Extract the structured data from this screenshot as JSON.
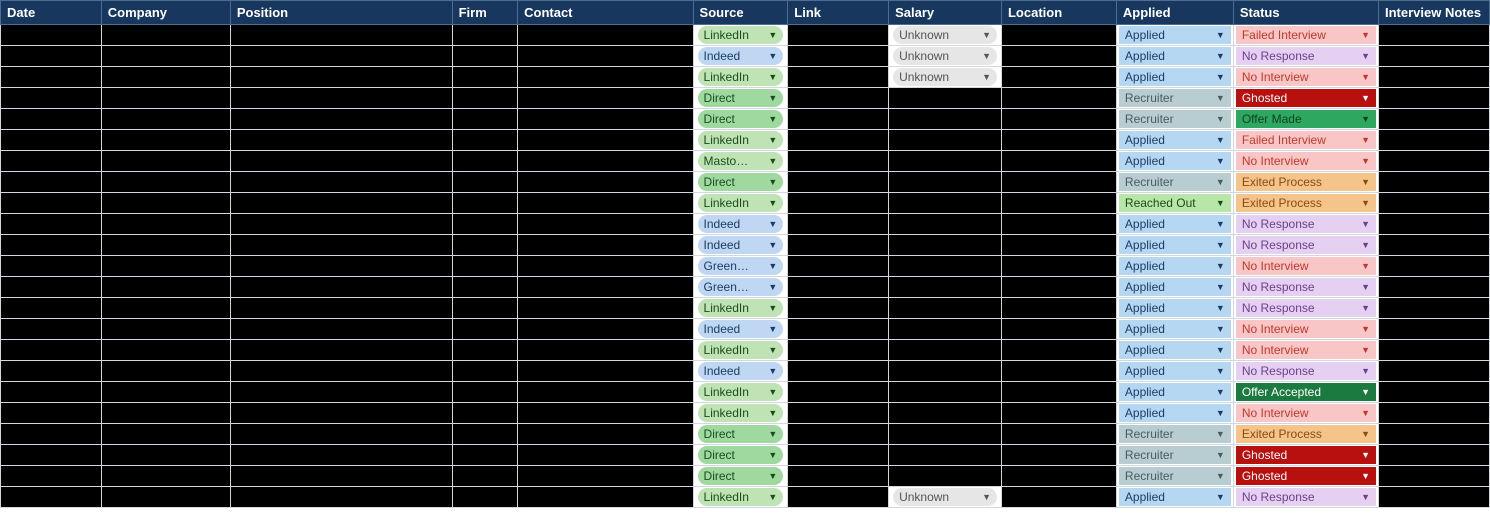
{
  "headers": {
    "date": "Date",
    "company": "Company",
    "position": "Position",
    "firm": "Firm",
    "contact": "Contact",
    "source": "Source",
    "link": "Link",
    "salary": "Salary",
    "location": "Location",
    "applied": "Applied",
    "status": "Status",
    "notes": "Interview Notes"
  },
  "source_styles": {
    "LinkedIn": "pill-linkedin",
    "Indeed": "pill-indeed",
    "Direct": "pill-direct",
    "Masto…": "pill-masto",
    "Green…": "pill-green"
  },
  "salary_styles": {
    "Unknown": "pill-unknown"
  },
  "applied_styles": {
    "Applied": "ap-applied",
    "Recruiter": "ap-recruiter",
    "Reached Out": "ap-reached"
  },
  "status_styles": {
    "Failed Interview": "st-failed",
    "No Response": "st-nores",
    "No Interview": "st-noint",
    "Ghosted": "st-ghosted",
    "Offer Made": "st-offer",
    "Offer Accepted": "st-accepted",
    "Exited Process": "st-exited"
  },
  "rows": [
    {
      "source": "LinkedIn",
      "salary": "Unknown",
      "applied": "Applied",
      "status": "Failed Interview"
    },
    {
      "source": "Indeed",
      "salary": "Unknown",
      "applied": "Applied",
      "status": "No Response"
    },
    {
      "source": "LinkedIn",
      "salary": "Unknown",
      "applied": "Applied",
      "status": "No Interview"
    },
    {
      "source": "Direct",
      "salary": "",
      "applied": "Recruiter",
      "status": "Ghosted"
    },
    {
      "source": "Direct",
      "salary": "",
      "applied": "Recruiter",
      "status": "Offer Made"
    },
    {
      "source": "LinkedIn",
      "salary": "",
      "applied": "Applied",
      "status": "Failed Interview"
    },
    {
      "source": "Masto…",
      "salary": "",
      "applied": "Applied",
      "status": "No Interview"
    },
    {
      "source": "Direct",
      "salary": "",
      "applied": "Recruiter",
      "status": "Exited Process"
    },
    {
      "source": "LinkedIn",
      "salary": "",
      "applied": "Reached Out",
      "status": "Exited Process"
    },
    {
      "source": "Indeed",
      "salary": "",
      "applied": "Applied",
      "status": "No Response"
    },
    {
      "source": "Indeed",
      "salary": "",
      "applied": "Applied",
      "status": "No Response"
    },
    {
      "source": "Green…",
      "salary": "",
      "applied": "Applied",
      "status": "No Interview"
    },
    {
      "source": "Green…",
      "salary": "",
      "applied": "Applied",
      "status": "No Response"
    },
    {
      "source": "LinkedIn",
      "salary": "",
      "applied": "Applied",
      "status": "No Response"
    },
    {
      "source": "Indeed",
      "salary": "",
      "applied": "Applied",
      "status": "No Interview"
    },
    {
      "source": "LinkedIn",
      "salary": "",
      "applied": "Applied",
      "status": "No Interview"
    },
    {
      "source": "Indeed",
      "salary": "",
      "applied": "Applied",
      "status": "No Response"
    },
    {
      "source": "LinkedIn",
      "salary": "",
      "applied": "Applied",
      "status": "Offer Accepted"
    },
    {
      "source": "LinkedIn",
      "salary": "",
      "applied": "Applied",
      "status": "No Interview"
    },
    {
      "source": "Direct",
      "salary": "",
      "applied": "Recruiter",
      "status": "Exited Process"
    },
    {
      "source": "Direct",
      "salary": "",
      "applied": "Recruiter",
      "status": "Ghosted"
    },
    {
      "source": "Direct",
      "salary": "",
      "applied": "Recruiter",
      "status": "Ghosted"
    },
    {
      "source": "LinkedIn",
      "salary": "Unknown",
      "applied": "Applied",
      "status": "No Response"
    }
  ]
}
